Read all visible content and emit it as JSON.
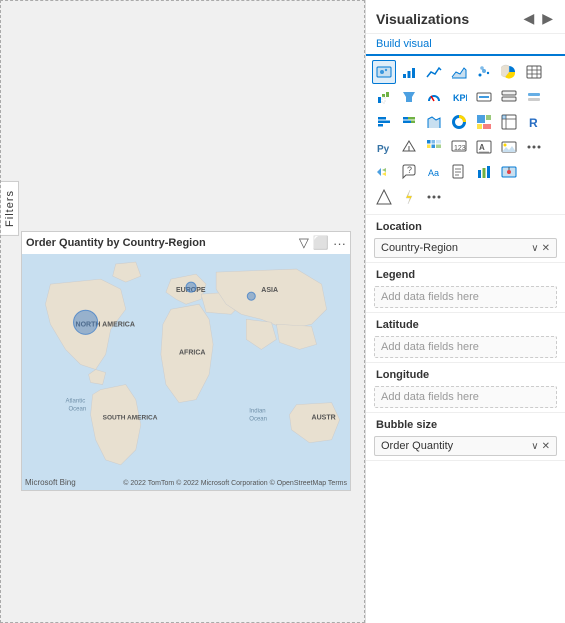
{
  "canvas": {
    "filters_label": "Filters"
  },
  "visual": {
    "title": "Order Quantity by Country-Region",
    "map_labels": {
      "north_america": "NORTH AMERICA",
      "south_america": "SOUTH AMERICA",
      "europe": "EUROPE",
      "asia": "ASIA",
      "africa": "AFRICA",
      "atlantic_ocean": "Atlantic\nOcean",
      "indian_ocean": "Indian\nOcean",
      "austr": "AUSTR"
    },
    "bing_logo": "Microsoft Bing",
    "attribution": "© 2022 TomTom © 2022 Microsoft Corporation © OpenStreetMap Terms"
  },
  "panel": {
    "title": "Visualizations",
    "build_visual_tab": "Build visual",
    "nav_left": "◀",
    "nav_right": "▶",
    "fields": [
      {
        "label": "Location",
        "pills": [
          {
            "text": "Country-Region",
            "has_chevron": true,
            "has_remove": true
          }
        ],
        "placeholder": null
      },
      {
        "label": "Legend",
        "pills": [],
        "placeholder": "Add data fields here"
      },
      {
        "label": "Latitude",
        "pills": [],
        "placeholder": "Add data fields here"
      },
      {
        "label": "Longitude",
        "pills": [],
        "placeholder": "Add data fields here"
      },
      {
        "label": "Bubble size",
        "pills": [
          {
            "text": "Order Quantity",
            "has_chevron": true,
            "has_remove": true
          }
        ],
        "placeholder": null
      }
    ]
  }
}
